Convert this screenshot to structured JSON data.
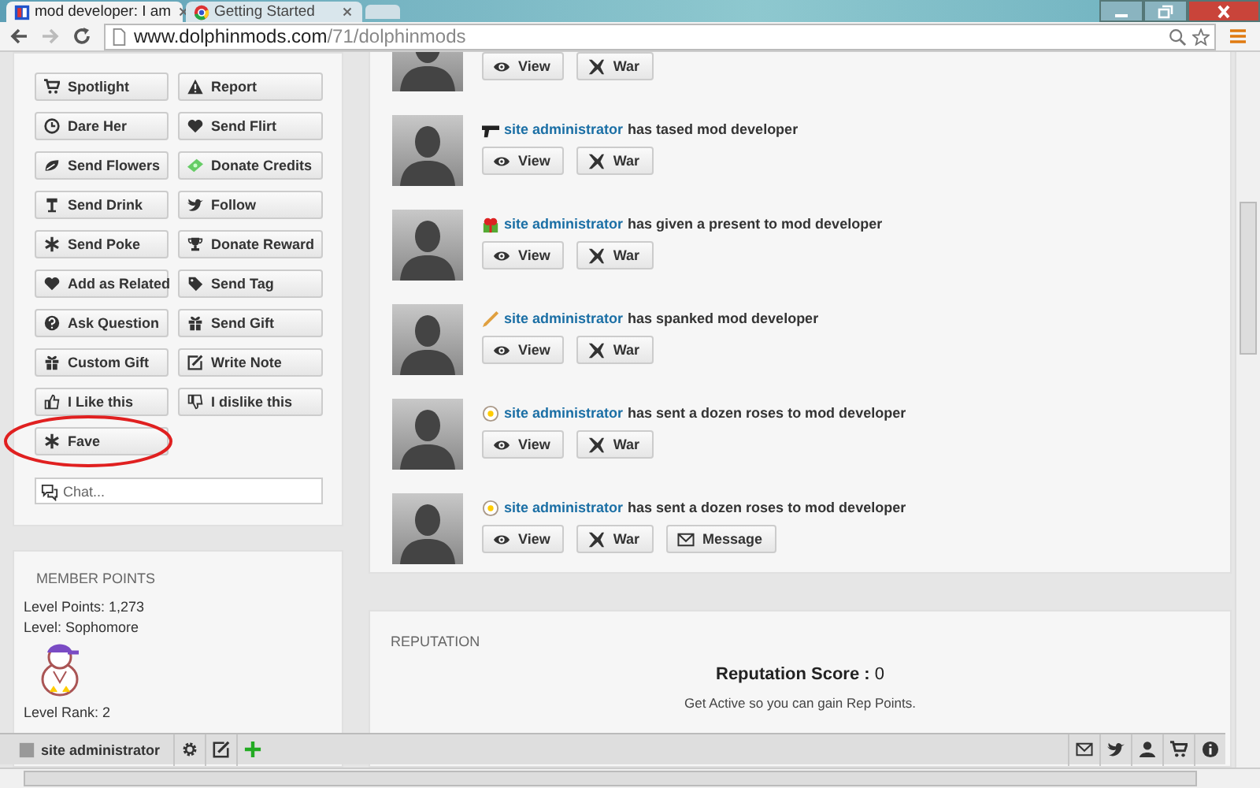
{
  "browser": {
    "tabs": [
      {
        "title": "mod developer: I am",
        "selected": true
      },
      {
        "title": "Getting Started",
        "selected": false
      }
    ],
    "address_host": "www.dolphinmods.com",
    "address_path": "/71/dolphinmods"
  },
  "actions": [
    {
      "label": "Spotlight",
      "kind": "cart",
      "circled": false
    },
    {
      "label": "Report",
      "kind": "warning",
      "circled": false
    },
    {
      "label": "Dare Her",
      "kind": "clock",
      "circled": false
    },
    {
      "label": "Send Flirt",
      "kind": "heart",
      "circled": false
    },
    {
      "label": "Send Flowers",
      "kind": "leaf",
      "circled": false
    },
    {
      "label": "Donate Credits",
      "kind": "money",
      "circled": false
    },
    {
      "label": "Send Drink",
      "kind": "glass",
      "circled": false
    },
    {
      "label": "Follow",
      "kind": "bird",
      "circled": false
    },
    {
      "label": "Send Poke",
      "kind": "asterisk",
      "circled": false
    },
    {
      "label": "Donate Reward",
      "kind": "trophy",
      "circled": false
    },
    {
      "label": "Add as Related",
      "kind": "heart",
      "circled": false
    },
    {
      "label": "Send Tag",
      "kind": "tag",
      "circled": false
    },
    {
      "label": "Ask Question",
      "kind": "question",
      "circled": false
    },
    {
      "label": "Send Gift",
      "kind": "gift",
      "circled": false
    },
    {
      "label": "Custom Gift",
      "kind": "gift",
      "circled": false
    },
    {
      "label": "Write Note",
      "kind": "edit",
      "circled": false
    },
    {
      "label": "I Like this",
      "kind": "thumbup",
      "circled": false
    },
    {
      "label": "I dislike this",
      "kind": "thumbdown",
      "circled": false
    },
    {
      "label": "Fave",
      "kind": "asterisk",
      "circled": true
    }
  ],
  "chat": {
    "placeholder": "Chat..."
  },
  "member_points": {
    "title": "MEMBER POINTS",
    "lines": [
      "Level Points: 1,273",
      "Level: Sophomore"
    ],
    "rank": "Level Rank: 2"
  },
  "feed": [
    {
      "buttons": [
        {
          "label": "View",
          "kind": "view"
        },
        {
          "label": "War",
          "kind": "war"
        }
      ]
    },
    {
      "kind": "gun",
      "actor": "site administrator",
      "text": "has tased mod developer",
      "buttons": [
        {
          "label": "View",
          "kind": "view"
        },
        {
          "label": "War",
          "kind": "war"
        }
      ]
    },
    {
      "kind": "present",
      "actor": "site administrator",
      "text": "has given a present to mod developer",
      "buttons": [
        {
          "label": "View",
          "kind": "view"
        },
        {
          "label": "War",
          "kind": "war"
        }
      ]
    },
    {
      "kind": "pencil",
      "actor": "site administrator",
      "text": "has spanked mod developer",
      "buttons": [
        {
          "label": "View",
          "kind": "view"
        },
        {
          "label": "War",
          "kind": "war"
        }
      ]
    },
    {
      "kind": "flower",
      "actor": "site administrator",
      "text": "has sent a dozen roses to mod developer",
      "buttons": [
        {
          "label": "View",
          "kind": "view"
        },
        {
          "label": "War",
          "kind": "war"
        }
      ]
    },
    {
      "kind": "flower",
      "actor": "site administrator",
      "text": "has sent a dozen roses to mod developer",
      "buttons": [
        {
          "label": "View",
          "kind": "view"
        },
        {
          "label": "War",
          "kind": "war"
        },
        {
          "label": "Message",
          "kind": "message"
        }
      ]
    }
  ],
  "reputation": {
    "title": "REPUTATION",
    "score_label": "Reputation Score :",
    "score": "0",
    "hint": "Get Active so you can gain Rep Points."
  },
  "bottom_bar": {
    "user": "site administrator"
  }
}
